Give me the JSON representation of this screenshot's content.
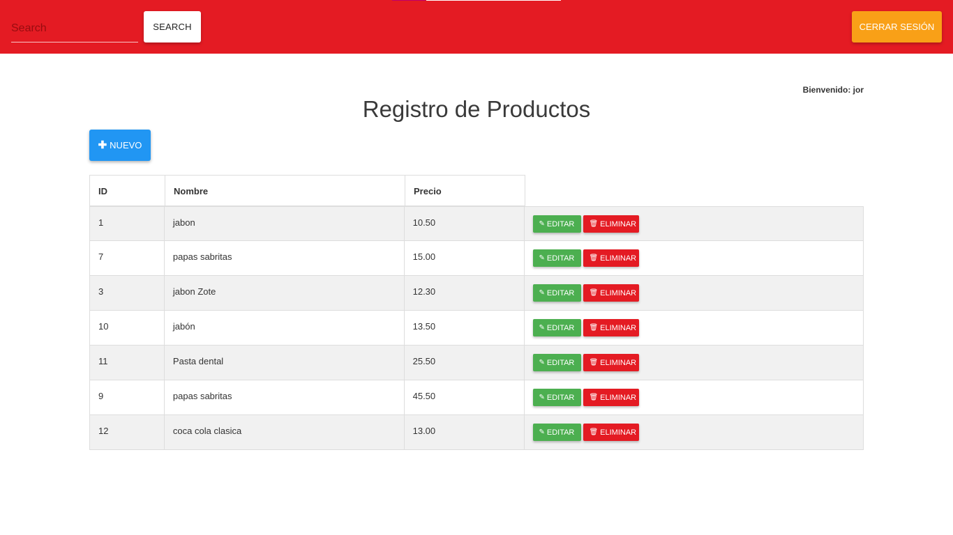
{
  "navbar": {
    "search_placeholder": "Search",
    "search_button": "SEARCH",
    "logout_button": "CERRAR SESIÓN",
    "bg_color": "#e41b23"
  },
  "header": {
    "welcome": "Bienvenido: jor",
    "title": "Registro de Productos"
  },
  "toolbar": {
    "new_button": "NUEVO",
    "new_icon": "plus-icon"
  },
  "table": {
    "columns": [
      "ID",
      "Nombre",
      "Precio"
    ],
    "edit_label": "EDITAR",
    "delete_label": "ELIMINAR",
    "edit_icon": "edit-icon",
    "delete_icon": "trash-icon",
    "rows": [
      {
        "id": "1",
        "name": "jabon",
        "price": "10.50"
      },
      {
        "id": "7",
        "name": "papas sabritas",
        "price": "15.00"
      },
      {
        "id": "3",
        "name": "jabon Zote",
        "price": "12.30"
      },
      {
        "id": "10",
        "name": "jabón",
        "price": "13.50"
      },
      {
        "id": "11",
        "name": "Pasta dental",
        "price": "25.50"
      },
      {
        "id": "9",
        "name": "papas sabritas",
        "price": "45.50"
      },
      {
        "id": "12",
        "name": "coca cola clasica",
        "price": "13.00"
      }
    ]
  },
  "colors": {
    "primary": "#2196f3",
    "success": "#4caf50",
    "danger": "#e41b23",
    "warning": "#f9a017"
  }
}
